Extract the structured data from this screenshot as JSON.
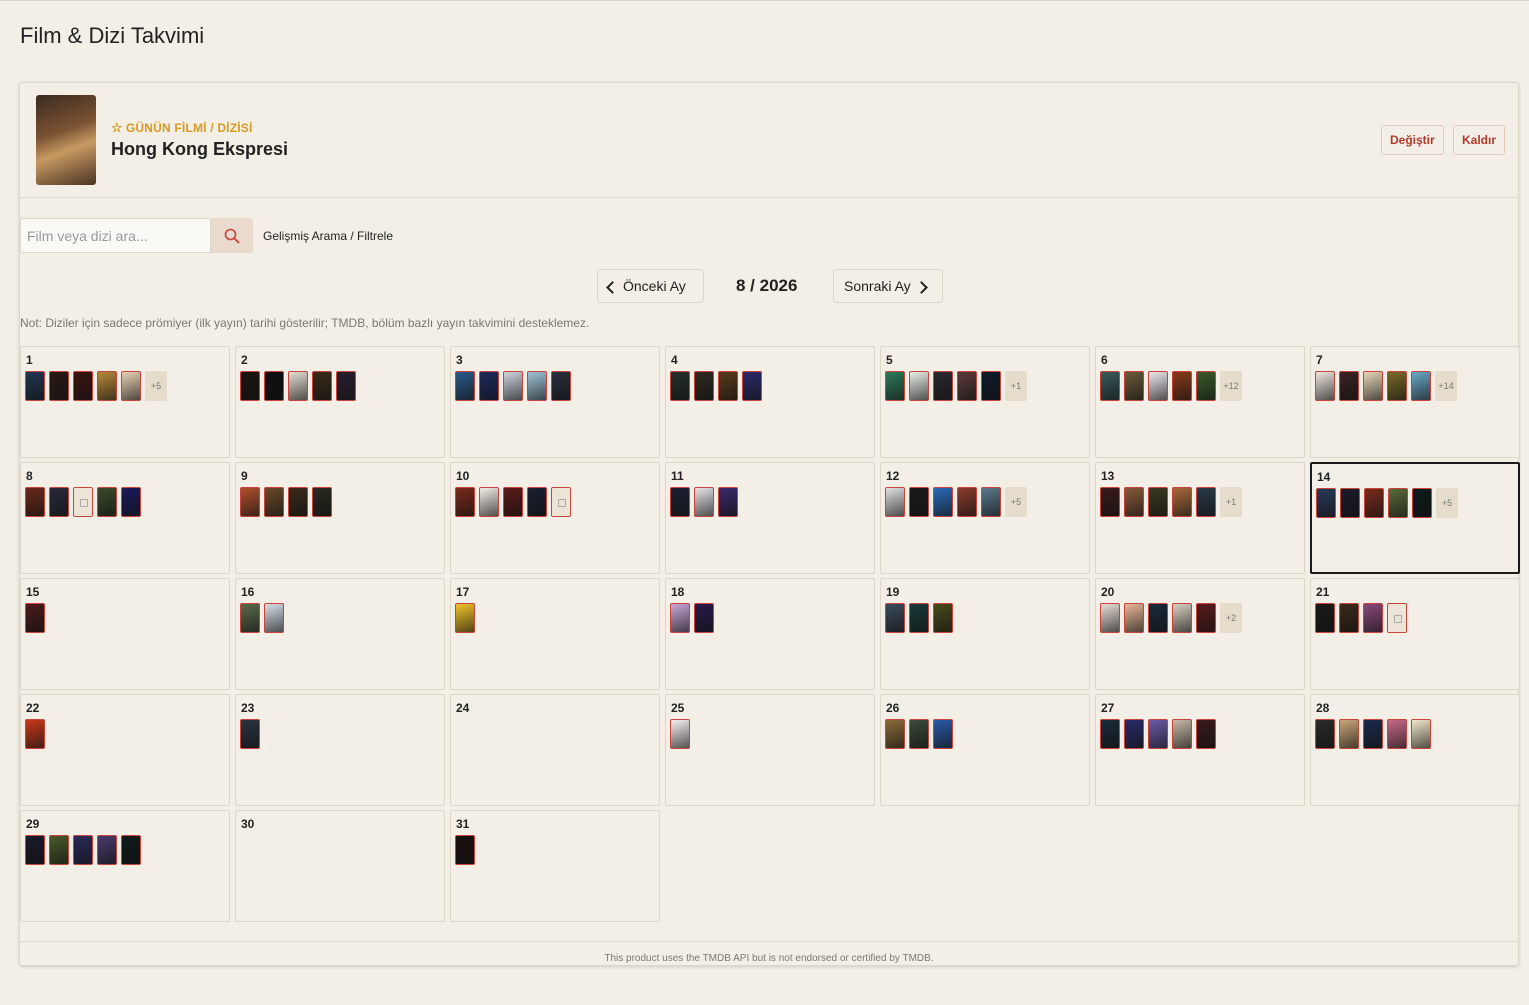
{
  "app": {
    "title": "Film & Dizi Takvimi"
  },
  "featured": {
    "tag": "GÜNÜN FİLMİ / DİZİSİ",
    "title": "Hong Kong Ekspresi",
    "change_label": "Değiştir",
    "remove_label": "Kaldır"
  },
  "search": {
    "placeholder": "Film veya dizi ara...",
    "value": "",
    "advanced_label": "Gelişmiş Arama / Filtrele"
  },
  "nav": {
    "prev_label": "Önceki Ay",
    "next_label": "Sonraki Ay",
    "month_label": "8 / 2026"
  },
  "note": "Not: Diziler için sadece prömiyer (ilk yayın) tarihi gösterilir; TMDB, bölüm bazlı yayın takvimini desteklemez.",
  "footer": "This product uses the TMDB API but is not endorsed or certified by TMDB.",
  "today": 14,
  "days": [
    {
      "day": "1",
      "posters": [
        "#1f3550",
        "#2a1a16",
        "#3a1410",
        "#b58a3a",
        "#e8d2b4"
      ],
      "more": "+5"
    },
    {
      "day": "2",
      "posters": [
        "#1a1410",
        "#0f0f0f",
        "#e6ded2",
        "#3a2a1a",
        "#2b1e2e"
      ],
      "more": ""
    },
    {
      "day": "3",
      "posters": [
        "#2a5a8a",
        "#1e2a5e",
        "#cfd4e0",
        "#9fc4d8",
        "#2a2e3e"
      ],
      "more": ""
    },
    {
      "day": "4",
      "posters": [
        "#22302a",
        "#2e2a22",
        "#5a3a1a",
        "#2a2a6a"
      ],
      "more": ""
    },
    {
      "day": "5",
      "posters": [
        "#2e7a5a",
        "#e8eee8",
        "#2a2a2e",
        "#5a3a3a",
        "#0e1a2a"
      ],
      "more": "+1"
    },
    {
      "day": "6",
      "posters": [
        "#3a5a5a",
        "#6a5a3a",
        "#ece8ee",
        "#8a3a1a",
        "#3a5a2a"
      ],
      "more": "+12"
    },
    {
      "day": "7",
      "posters": [
        "#efe6e0",
        "#3a2222",
        "#e8d6b8",
        "#7a6a2a",
        "#6aa8c8"
      ],
      "more": "+14"
    },
    {
      "day": "8",
      "posters": [
        "#6a2a1a",
        "#2a2a3a",
        "placeholder",
        "#3a4a2a",
        "#1a1a5a"
      ],
      "more": ""
    },
    {
      "day": "9",
      "posters": [
        "#b0502a",
        "#6a4a2a",
        "#3a2a1a",
        "#2a2a22"
      ],
      "more": ""
    },
    {
      "day": "10",
      "posters": [
        "#7a2a1a",
        "#f2ece6",
        "#5a1a1a",
        "#1a2030",
        "placeholder"
      ],
      "more": ""
    },
    {
      "day": "11",
      "posters": [
        "#1a2230",
        "#e8e4e6",
        "#3a2a6a"
      ],
      "more": ""
    },
    {
      "day": "12",
      "posters": [
        "#e0e0e0",
        "#1a1a1a",
        "#2a6ab8",
        "#8a3a2a",
        "#5a7a8a"
      ],
      "more": "+5"
    },
    {
      "day": "13",
      "posters": [
        "#3a1a1a",
        "#8a5a3a",
        "#3a3a22",
        "#a86a3a",
        "#2a3a4a"
      ],
      "more": "+1"
    },
    {
      "day": "14",
      "posters": [
        "#2a3a5a",
        "#1a1a2a",
        "#7a2a1a",
        "#5a6a3a",
        "#0e1a1a"
      ],
      "more": "+5"
    },
    {
      "day": "15",
      "posters": [
        "#4a1a1a"
      ],
      "more": ""
    },
    {
      "day": "16",
      "posters": [
        "#5a6a4a",
        "#d8e0ea"
      ],
      "more": ""
    },
    {
      "day": "17",
      "posters": [
        "#f2c42a"
      ],
      "more": ""
    },
    {
      "day": "18",
      "posters": [
        "#c8a8d8",
        "#2a1a4a"
      ],
      "more": ""
    },
    {
      "day": "19",
      "posters": [
        "#3a4a5a",
        "#1a3a3a",
        "#4a4a1a"
      ],
      "more": ""
    },
    {
      "day": "20",
      "posters": [
        "#e8e0d8",
        "#e8b898",
        "#1a2a3a",
        "#d8d0c0",
        "#5a1a1a"
      ],
      "more": "+2"
    },
    {
      "day": "21",
      "posters": [
        "#1a1a1a",
        "#3a2a1a",
        "#8a4a7a",
        "placeholder"
      ],
      "more": ""
    },
    {
      "day": "22",
      "posters": [
        "#c83a1a"
      ],
      "more": ""
    },
    {
      "day": "23",
      "posters": [
        "#2a3440"
      ],
      "more": ""
    },
    {
      "day": "24",
      "posters": [],
      "more": ""
    },
    {
      "day": "25",
      "posters": [
        "#f6f2f0"
      ],
      "more": ""
    },
    {
      "day": "26",
      "posters": [
        "#8a6a3a",
        "#3a4a3a",
        "#2a5aa8"
      ],
      "more": ""
    },
    {
      "day": "27",
      "posters": [
        "#1a2a3a",
        "#2a2a6a",
        "#6a5aa8",
        "#c8b8a8",
        "#3a1a1a"
      ],
      "more": ""
    },
    {
      "day": "28",
      "posters": [
        "#2a2a2a",
        "#c8a87a",
        "#1a2a4a",
        "#c86a8a",
        "#f0e8c8"
      ],
      "more": ""
    },
    {
      "day": "29",
      "posters": [
        "#1a1a2a",
        "#4a5a2a",
        "#2a2a5a",
        "#4a3a6a",
        "#0e1a1a"
      ],
      "more": ""
    },
    {
      "day": "30",
      "posters": [],
      "more": ""
    },
    {
      "day": "31",
      "posters": [
        "#1a0e0e"
      ],
      "more": ""
    }
  ]
}
